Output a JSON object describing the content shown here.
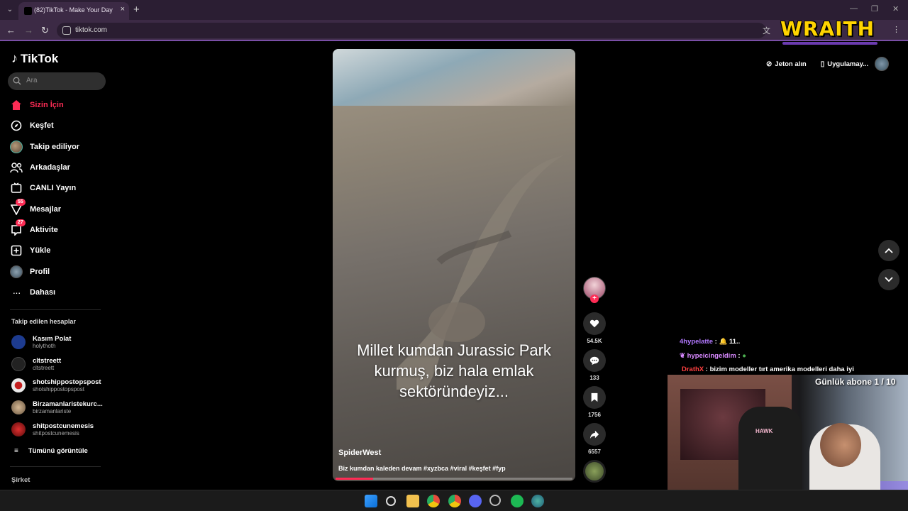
{
  "browser": {
    "tab_title": "(82)TikTok - Make Your Day",
    "url": "tiktok.com"
  },
  "overlay": {
    "brand": "WRAITH"
  },
  "tiktok": {
    "logo": "TikTok",
    "search_placeholder": "Ara",
    "nav": [
      {
        "label": "Sizin İçin",
        "icon": "home-icon",
        "active": true
      },
      {
        "label": "Keşfet",
        "icon": "compass-icon"
      },
      {
        "label": "Takip ediliyor",
        "icon": "following-avatar"
      },
      {
        "label": "Arkadaşlar",
        "icon": "friends-icon"
      },
      {
        "label": "CANLI Yayın",
        "icon": "live-icon"
      },
      {
        "label": "Mesajlar",
        "icon": "messages-icon",
        "badge": "55"
      },
      {
        "label": "Aktivite",
        "icon": "activity-icon",
        "badge": "27"
      },
      {
        "label": "Yükle",
        "icon": "upload-icon"
      },
      {
        "label": "Profil",
        "icon": "profile-avatar"
      },
      {
        "label": "Dahası",
        "icon": "more-icon"
      }
    ],
    "following_title": "Takip edilen hesaplar",
    "following": [
      {
        "name": "Kasım Polat",
        "handle": "holythoth",
        "color": "#1d3b8f"
      },
      {
        "name": "cltstreett",
        "handle": "cltstreett",
        "color": "#222222"
      },
      {
        "name": "shotshippostopspost",
        "handle": "shotshippostopspost",
        "color": "#e9e9e9"
      },
      {
        "name": "Birzamanlaristekurc...",
        "handle": "birzamanlariste",
        "color": "#b89a7a"
      },
      {
        "name": "shitpostcunemesis",
        "handle": "shitpostcunemesis",
        "color": "#a01818"
      }
    ],
    "see_all": "Tümünü görüntüle",
    "company": "Şirket",
    "video": {
      "caption": "Millet kumdan Jurassic Park kurmuş, biz hala emlak sektöründeyiz...",
      "author": "SpiderWest",
      "description": "Biz kumdan kaleden devam #xyzbca #viral #keşfet #fyp",
      "progress": 0.16,
      "likes": "54.5K",
      "comments": "133",
      "saves": "1756",
      "shares": "6557"
    },
    "get_coins": "Jeton alın",
    "get_app": "Uygulamay..."
  },
  "stream": {
    "chat": [
      {
        "user": "4hypelatte",
        "message": "11.."
      },
      {
        "user": "hypeicingeldim",
        "message": ""
      },
      {
        "user": "DrathX",
        "message": "bizim modeller tırt amerika modelleri daha iyi"
      }
    ],
    "sub_goal": "Günlük abone 1 / 10",
    "chair_brand": "HAWK"
  }
}
